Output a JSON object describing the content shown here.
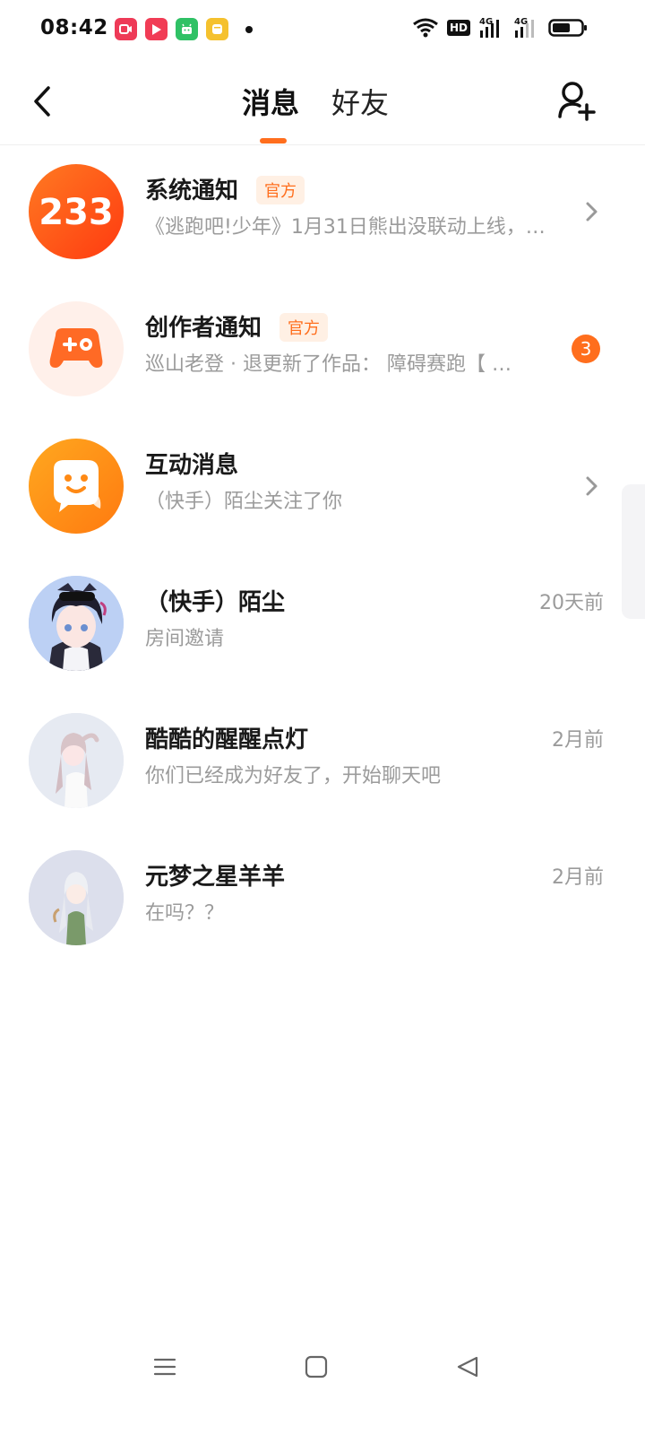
{
  "status_bar": {
    "time": "08:42",
    "network_badge": "HD",
    "signal1": "4G",
    "signal2": "4G"
  },
  "nav": {
    "tabs": [
      {
        "label": "消息",
        "active": true
      },
      {
        "label": "好友",
        "active": false
      }
    ],
    "accent_color": "#ff6e1d"
  },
  "messages": [
    {
      "title": "系统通知",
      "badge": "官方",
      "subtitle": "《逃跑吧!少年》1月31日熊出没联动上线，…",
      "avatar_text": "233",
      "right": "chevron"
    },
    {
      "title": "创作者通知",
      "badge": "官方",
      "subtitle": "巡山老登 · 退更新了作品：  障碍赛跑【 …",
      "unread": "3",
      "right": "count"
    },
    {
      "title": "互动消息",
      "subtitle": "（快手）陌尘关注了你",
      "right": "chevron"
    },
    {
      "title": "（快手）陌尘",
      "subtitle": "房间邀请",
      "time": "20天前"
    },
    {
      "title": "酷酷的醒醒点灯",
      "subtitle": "你们已经成为好友了，开始聊天吧",
      "time": "2月前"
    },
    {
      "title": "元梦之星羊羊",
      "subtitle": "在吗？？",
      "time": "2月前"
    }
  ]
}
